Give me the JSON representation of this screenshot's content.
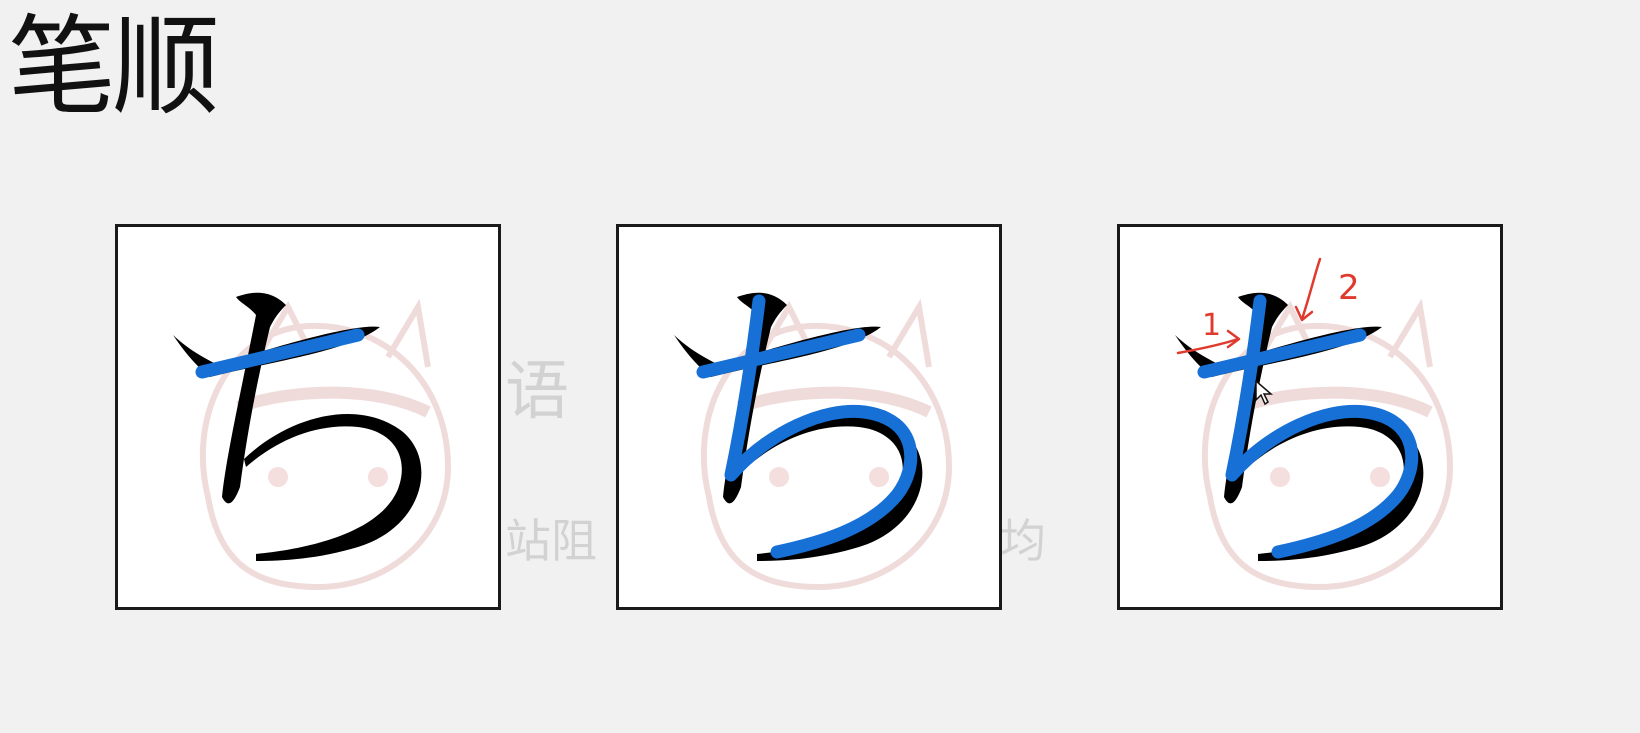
{
  "title": "笔顺",
  "panels": [
    {
      "name": "kana-panel-plain",
      "kana": "ち"
    },
    {
      "name": "kana-panel-traced",
      "kana": "ち"
    },
    {
      "name": "kana-panel-annotated",
      "kana": "ち"
    }
  ],
  "annotations": {
    "stroke_1": "1",
    "stroke_2": "2"
  },
  "colors": {
    "background": "#f1f1f1",
    "glyph": "#000000",
    "stroke_trace": "#1670d6",
    "annotation": "#e03a2f",
    "panel_border": "#1a1a1a"
  }
}
